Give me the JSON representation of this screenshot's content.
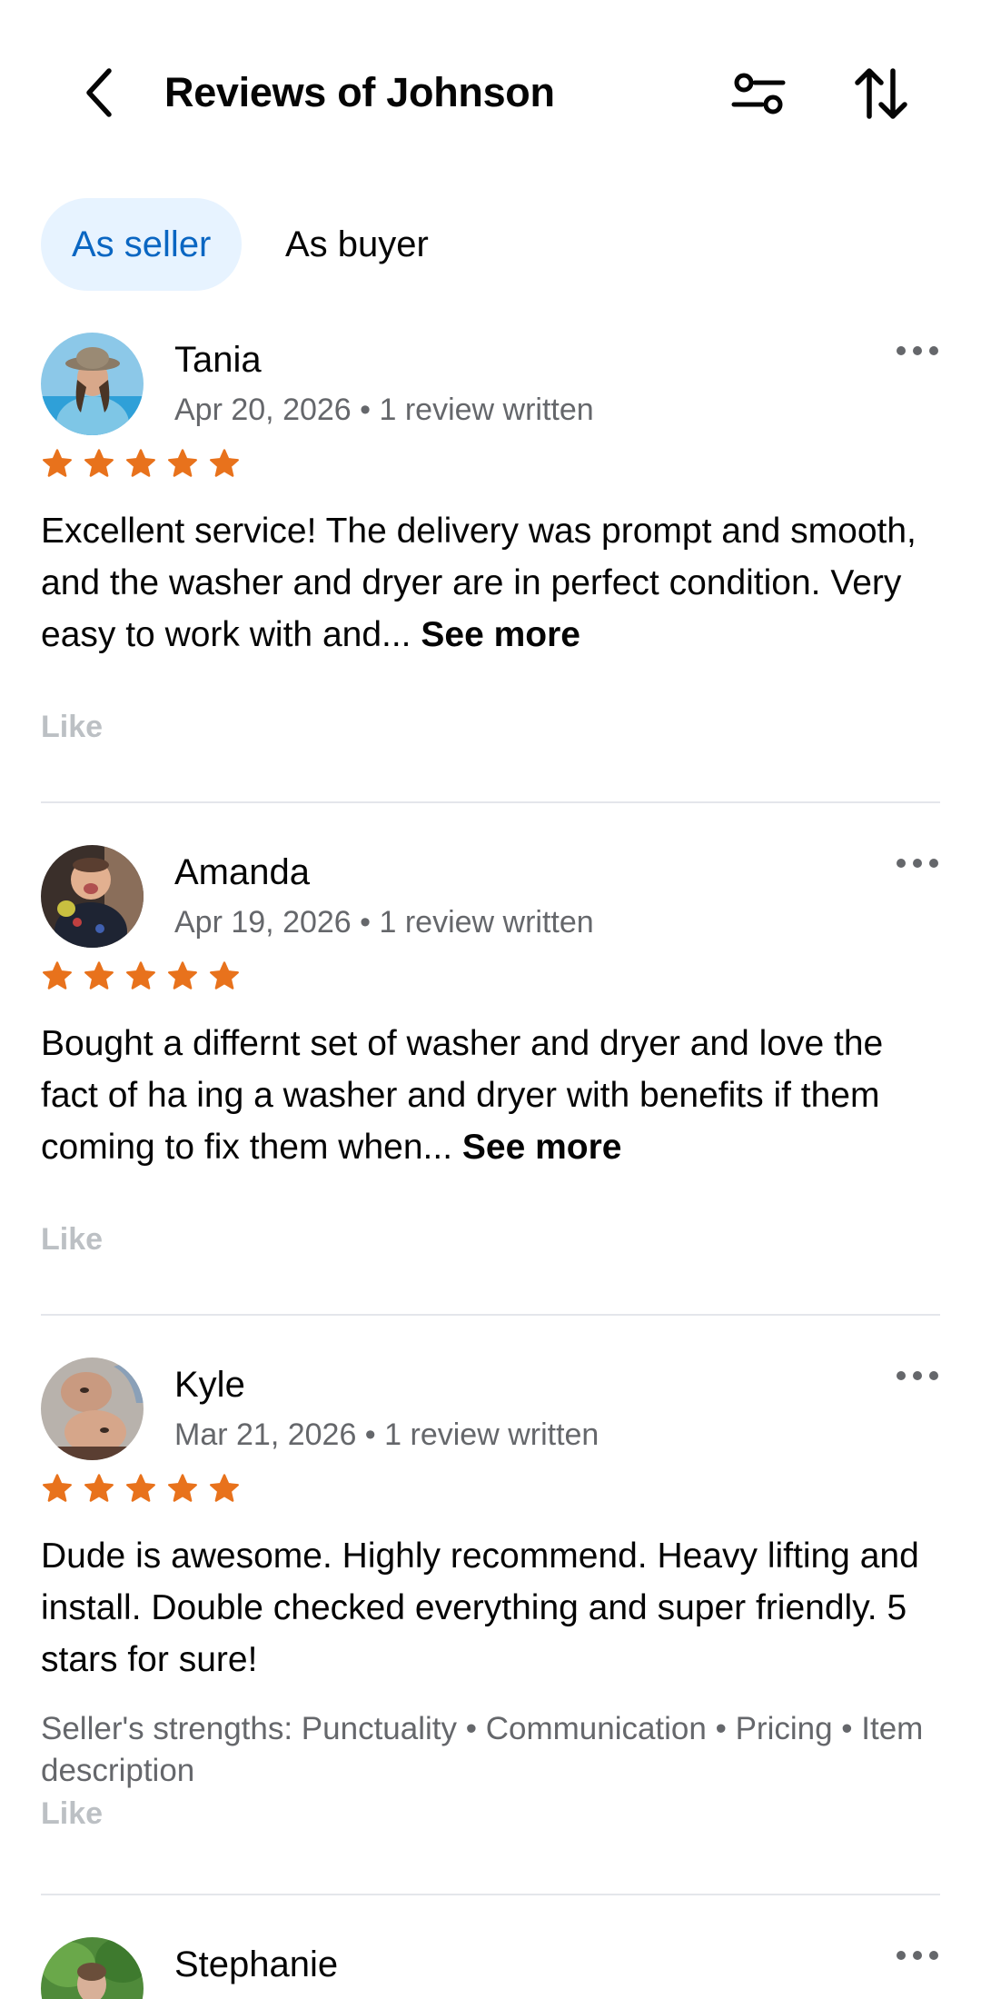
{
  "header": {
    "title": "Reviews of Johnson",
    "back_icon": "chevron-left-icon",
    "filter_icon": "sliders-icon",
    "sort_icon": "sort-arrows-icon"
  },
  "tabs": [
    {
      "label": "As seller",
      "active": true
    },
    {
      "label": "As buyer",
      "active": false
    }
  ],
  "colors": {
    "star": "#e8721c",
    "tab_active_bg": "#e7f3ff",
    "tab_active_text": "#0a66c2",
    "like": "#bcc0c4"
  },
  "reviews": [
    {
      "name": "Tania",
      "meta": "Apr 20, 2026 • 1 review written",
      "rating": 5,
      "text": "Excellent service! The delivery was prompt and smooth, and the washer and dryer are in perfect condition. Very easy to work with and...",
      "see_more": "See more",
      "like": "Like"
    },
    {
      "name": "Amanda",
      "meta": "Apr 19, 2026 • 1 review written",
      "rating": 5,
      "text": "Bought a differnt set of washer and dryer  and love the fact of ha ing a washer and dryer with benefits if them coming to fix them when...",
      "see_more": "See more",
      "like": "Like"
    },
    {
      "name": "Kyle",
      "meta": "Mar 21, 2026 • 1 review written",
      "rating": 5,
      "text": "Dude is awesome.  Highly recommend. Heavy lifting and install. Double checked everything and super friendly. 5 stars for sure!",
      "strengths": "Seller's strengths: Punctuality • Communication • Pricing • Item description",
      "like": "Like"
    },
    {
      "name": "Stephanie"
    }
  ]
}
